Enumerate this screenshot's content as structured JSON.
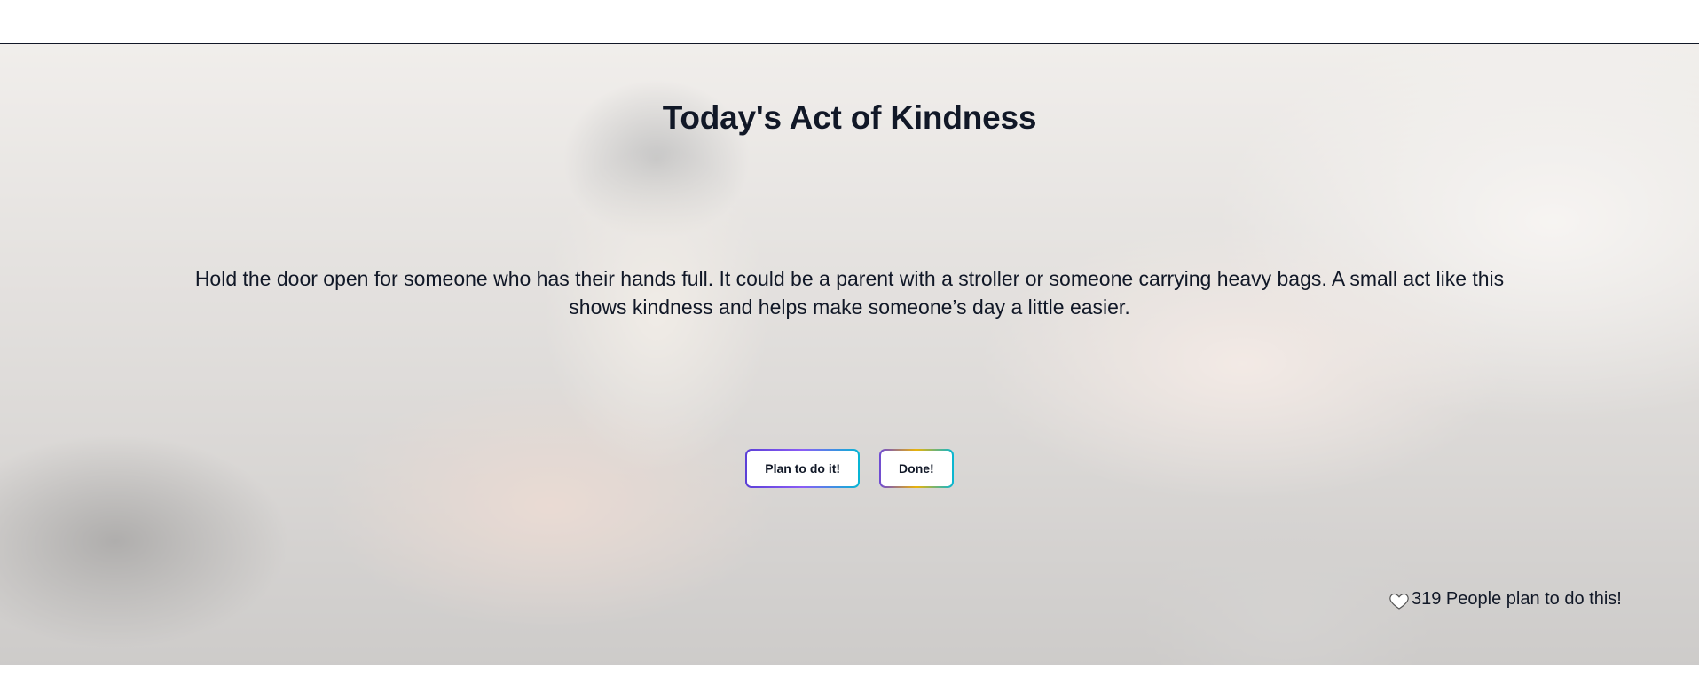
{
  "hero": {
    "title": "Today's Act of Kindness",
    "description": "Hold the door open for someone who has their hands full. It could be a parent with a stroller or someone carrying heavy bags. A small act like this shows kindness and helps make someone’s day a little easier."
  },
  "actions": {
    "plan_label": "Plan to do it!",
    "done_label": "Done!"
  },
  "stats": {
    "icon": "heart-icon",
    "plan_count_text": "319 People plan to do this!"
  },
  "colors": {
    "text": "#111827",
    "button_border_start": "#5b3fd6",
    "button_border_end": "#06b6d4"
  }
}
